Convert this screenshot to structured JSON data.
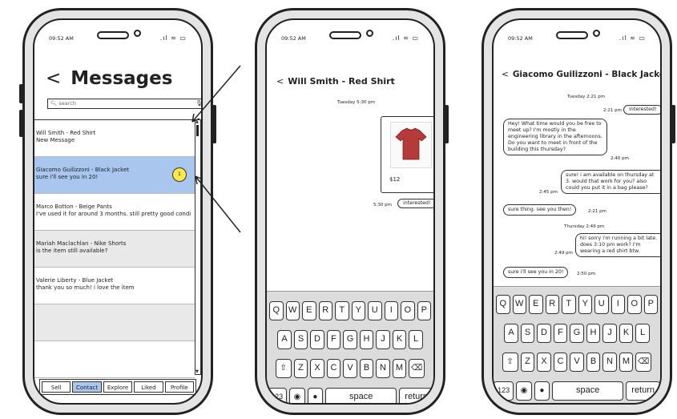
{
  "status_time": "09:52 AM",
  "status_icons": ".ıl ≈ ▭",
  "inbox": {
    "back": "<",
    "title": "Messages",
    "search_placeholder": "search",
    "conversations": [
      {
        "name": "Will Smith - Red Shirt",
        "preview": "New Message",
        "style": "plain"
      },
      {
        "name": "Giacomo Guilizzoni - Black Jacket",
        "preview": "sure i'll see you in 20!",
        "style": "selected",
        "badge": "1"
      },
      {
        "name": "Marco Botton - Beige Pants",
        "preview": "I've used it for around 3 months. still pretty good condi",
        "style": "plain"
      },
      {
        "name": "Mariah Maclachlan - Nike Shorts",
        "preview": "is the item still available?",
        "style": "alt"
      },
      {
        "name": "Valerie Liberty - Blue Jacket",
        "preview": "thank you so much! i love the item",
        "style": "plain"
      },
      {
        "name": "",
        "preview": "",
        "style": "alt"
      },
      {
        "name": "",
        "preview": "",
        "style": "plain"
      }
    ],
    "tabs": [
      {
        "label": "Sell",
        "active": false
      },
      {
        "label": "Contact",
        "active": true
      },
      {
        "label": "Explore",
        "active": false
      },
      {
        "label": "Liked",
        "active": false
      },
      {
        "label": "Profile",
        "active": false
      }
    ]
  },
  "chat1": {
    "title": "Will Smith - Red Shirt",
    "date": "Tuesday 5:30 pm",
    "price": "$12",
    "sent_time": "5:30 pm",
    "sent_text": "interested!"
  },
  "chat2": {
    "title": "Giacomo Guilizzoni - Black Jacket",
    "date1": "Tuesday 2:21 pm",
    "m1_time": "2:21 pm",
    "m1_text": "interested!",
    "m2_text": "Hey! What time would you be free to meet up? I'm mostly in the engineering library in the afternoons. Do you want to meet in front of the building this thursday?",
    "m2_time": "2:40 pm",
    "m3_time": "2:45 pm",
    "m3_text": "sure! i am available on thursday at 3. would that work for you? also could you put it in a bag please?",
    "m4_text": "sure thing. see you then!",
    "m4_time": "2:21 pm",
    "date2": "Thursday 2:49 pm",
    "m5_time": "2:49 pm",
    "m5_text": "hi! sorry i'm running a bit late. does 3:10 pm work? I'm wearing a red shirt btw.",
    "m6_text": "sure i'll see you in 20!",
    "m6_time": "2:50 pm"
  },
  "keyboard": {
    "row1": [
      "Q",
      "W",
      "E",
      "R",
      "T",
      "Y",
      "U",
      "I",
      "O",
      "P"
    ],
    "row2": [
      "A",
      "S",
      "D",
      "F",
      "G",
      "H",
      "J",
      "K",
      "L"
    ],
    "row3": [
      "Z",
      "X",
      "C",
      "V",
      "B",
      "N",
      "M"
    ],
    "shift": "⇧",
    "backspace": "⌫",
    "numbers": "123",
    "globe": "◉",
    "mic": "🎤",
    "space": "space",
    "return": "return"
  },
  "icons": {
    "search": "search-icon",
    "mic": "mic-icon",
    "back": "chevron-left-icon"
  },
  "colors": {
    "selected_row": "#a9c6ee",
    "active_tab": "#a9c6ee",
    "badge": "#fde94a"
  }
}
